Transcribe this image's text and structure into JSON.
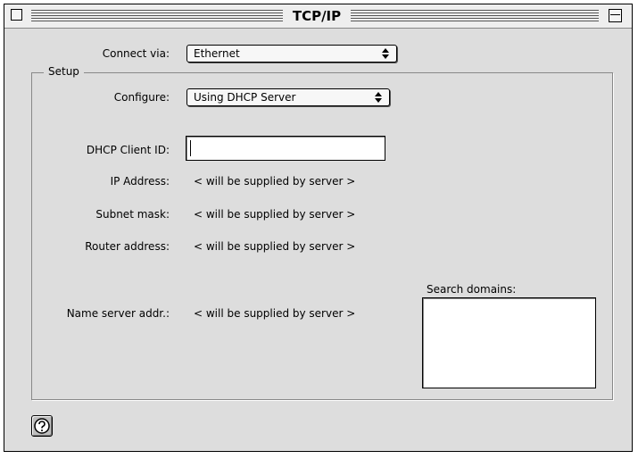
{
  "window": {
    "title": "TCP/IP"
  },
  "connect": {
    "label": "Connect via:",
    "selected": "Ethernet"
  },
  "setup": {
    "group_label": "Setup",
    "configure_label": "Configure:",
    "configure_selected": "Using DHCP Server",
    "dhcp_client_id_label": "DHCP Client ID:",
    "dhcp_client_id_value": "",
    "ip_address_label": "IP Address:",
    "ip_address_value": "< will be supplied by server >",
    "subnet_mask_label": "Subnet mask:",
    "subnet_mask_value": "< will be supplied by server >",
    "router_address_label": "Router address:",
    "router_address_value": "< will be supplied by server >",
    "name_server_label": "Name server addr.:",
    "name_server_value": "< will be supplied by server >",
    "search_domains_label": "Search domains:",
    "search_domains_value": ""
  },
  "icons": {
    "close": "close-box-icon",
    "zoom": "zoom-box-icon",
    "popup_arrows": "up-down-arrows-icon",
    "help": "question-mark-icon"
  }
}
